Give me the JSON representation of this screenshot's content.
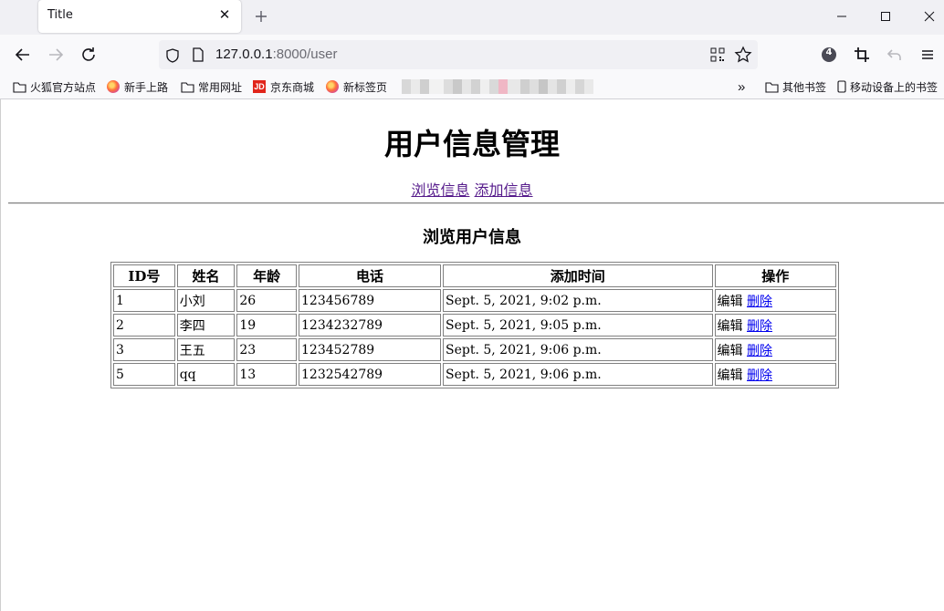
{
  "browser": {
    "tab_title": "Title",
    "url_host": "127.0.0.1",
    "url_rest": ":8000/user",
    "badge_count": "4",
    "bookmarks": [
      {
        "label": "火狐官方站点",
        "icon": "folder-icon"
      },
      {
        "label": "新手上路",
        "icon": "firefox-icon"
      },
      {
        "label": "常用网址",
        "icon": "folder-icon"
      },
      {
        "label": "京东商城",
        "icon": "jd-icon"
      },
      {
        "label": "新标签页",
        "icon": "firefox-icon"
      }
    ],
    "bookmark_overflow": "»",
    "other_bookmarks": "其他书签",
    "mobile_bookmarks": "移动设备上的书签",
    "colors": {
      "chrome_bg": "#f0f0f4",
      "toolbar_bg": "#f9f9fb"
    }
  },
  "page": {
    "title": "用户信息管理",
    "nav": {
      "browse": "浏览信息",
      "add": "添加信息"
    },
    "section_title": "浏览用户信息",
    "table": {
      "headers": [
        "ID号",
        "姓名",
        "年龄",
        "电话",
        "添加时间",
        "操作"
      ],
      "rows": [
        {
          "id": "1",
          "name": "小刘",
          "age": "26",
          "phone": "123456789",
          "time": "Sept. 5, 2021, 9:02 p.m.",
          "edit": "编辑",
          "delete": "删除"
        },
        {
          "id": "2",
          "name": "李四",
          "age": "19",
          "phone": "1234232789",
          "time": "Sept. 5, 2021, 9:05 p.m.",
          "edit": "编辑",
          "delete": "删除"
        },
        {
          "id": "3",
          "name": "王五",
          "age": "23",
          "phone": "123452789",
          "time": "Sept. 5, 2021, 9:06 p.m.",
          "edit": "编辑",
          "delete": "删除"
        },
        {
          "id": "5",
          "name": "qq",
          "age": "13",
          "phone": "1232542789",
          "time": "Sept. 5, 2021, 9:06 p.m.",
          "edit": "编辑",
          "delete": "删除"
        }
      ]
    },
    "colors": {
      "visited_link": "#551a8b",
      "link": "#0000ee"
    }
  }
}
